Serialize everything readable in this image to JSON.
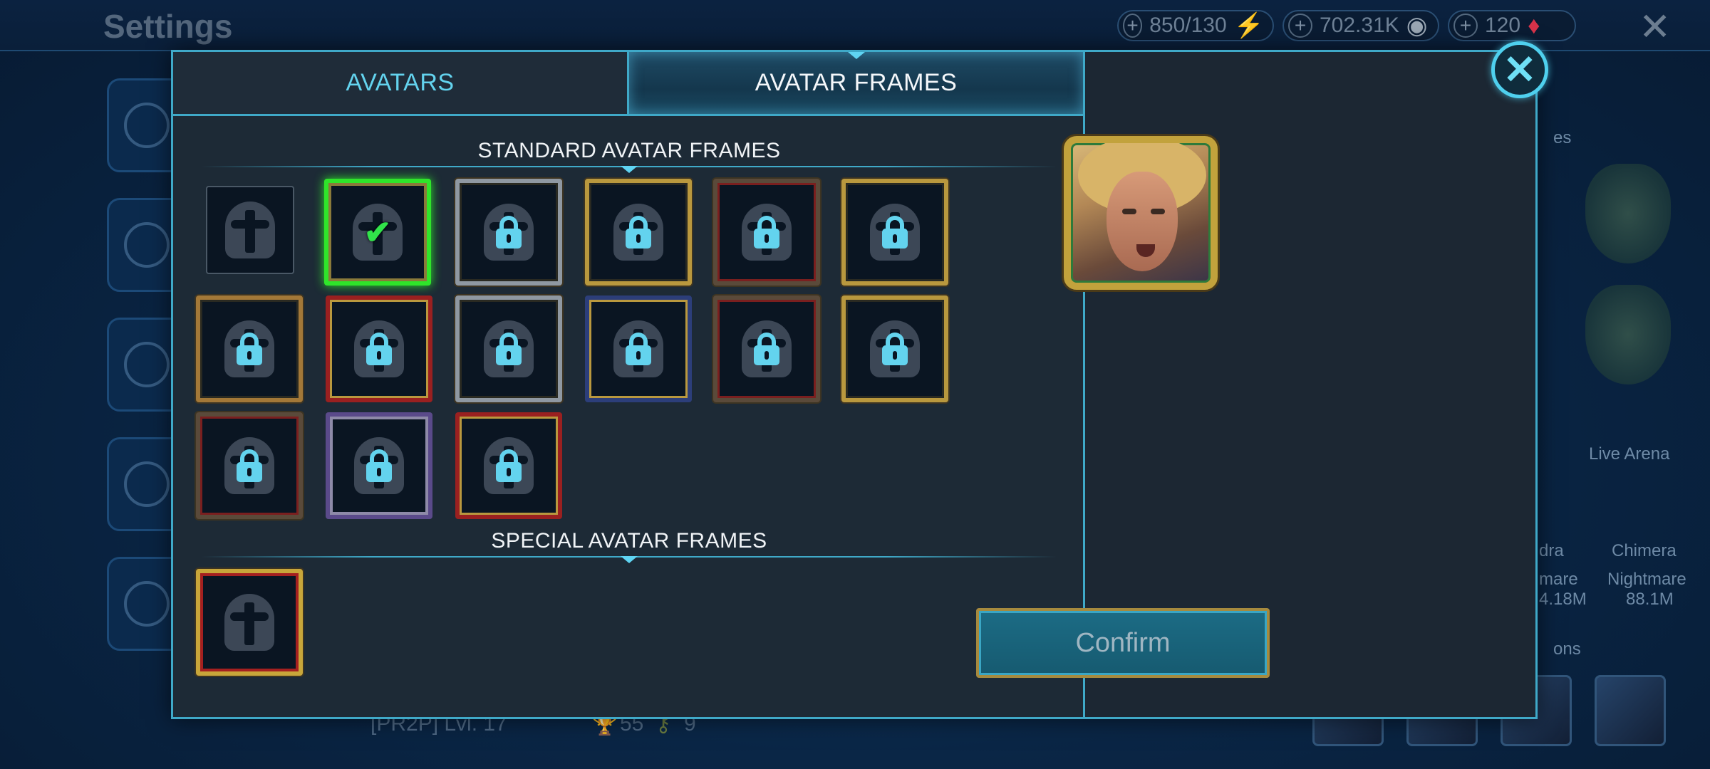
{
  "background": {
    "title": "Settings",
    "resources": [
      {
        "value": "850/130",
        "icon": "energy-icon",
        "glyph": "⚡",
        "color": "#a6c63a"
      },
      {
        "value": "702.31K",
        "icon": "silver-coin-icon",
        "glyph": "◉",
        "color": "#9aa7b4"
      },
      {
        "value": "120",
        "icon": "gem-icon",
        "glyph": "♦",
        "color": "#d8334a"
      }
    ],
    "close_glyph": "✕",
    "player_line": "[PR2P] Lvl. 17",
    "trophies": "55",
    "keys": "9",
    "right_labels": {
      "live_arena": "Live Arena",
      "chimera": "Chimera",
      "hydra_partial": "dra",
      "nightmare_1": "mare",
      "nightmare_2": "Nightmare",
      "value_1": "4.18M",
      "value_2": "88.1M",
      "partial_1": "es",
      "partial_2": "ons"
    }
  },
  "modal": {
    "tabs": {
      "avatars": "AVATARS",
      "avatar_frames": "AVATAR FRAMES"
    },
    "standard_heading": "STANDARD AVATAR FRAMES",
    "special_heading": "SPECIAL AVATAR FRAMES",
    "confirm_label": "Confirm",
    "close_glyph": "✕",
    "check_glyph": "✔"
  }
}
